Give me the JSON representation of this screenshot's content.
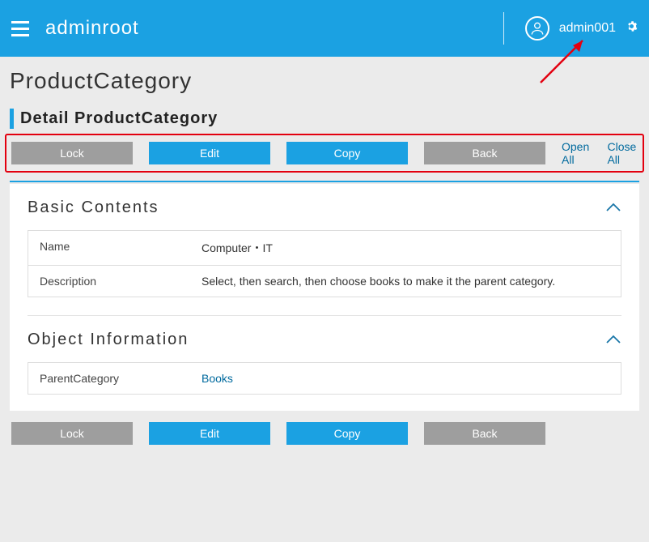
{
  "header": {
    "app_title": "adminroot",
    "username": "admin001"
  },
  "page": {
    "title": "ProductCategory",
    "section_title": "Detail ProductCategory"
  },
  "toolbar": {
    "lock": "Lock",
    "edit": "Edit",
    "copy": "Copy",
    "back": "Back",
    "open_all": "Open All",
    "close_all": "Close All"
  },
  "sections": {
    "basic": {
      "heading": "Basic Contents",
      "rows": [
        {
          "label": "Name",
          "value": "Computer・IT"
        },
        {
          "label": "Description",
          "value": "Select, then search, then choose books to make it the parent category."
        }
      ]
    },
    "object": {
      "heading": "Object Information",
      "rows": [
        {
          "label": "ParentCategory",
          "value": "Books"
        }
      ]
    }
  }
}
